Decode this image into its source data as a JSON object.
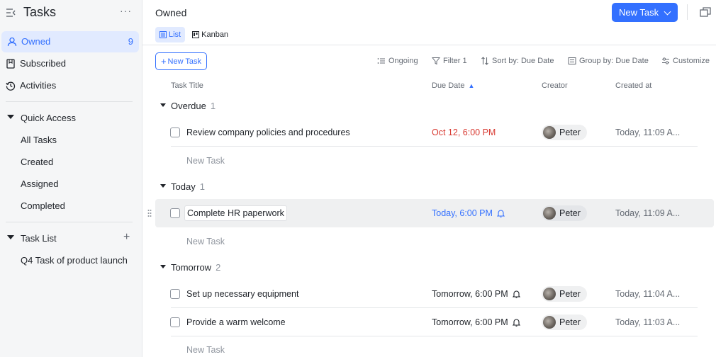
{
  "sidebar": {
    "title": "Tasks",
    "more": "···",
    "nav": [
      {
        "label": "Owned",
        "count": "9"
      },
      {
        "label": "Subscribed"
      },
      {
        "label": "Activities"
      }
    ],
    "quick_access": {
      "label": "Quick Access",
      "items": [
        "All Tasks",
        "Created",
        "Assigned",
        "Completed"
      ]
    },
    "task_list": {
      "label": "Task List",
      "add": "+",
      "items": [
        "Q4 Task of product launch"
      ]
    }
  },
  "header": {
    "title": "Owned",
    "new_task_button": "New Task",
    "views": [
      {
        "label": "List",
        "active": true
      },
      {
        "label": "Kanban",
        "active": false
      }
    ]
  },
  "toolbar": {
    "new_task": "New Task",
    "ongoing": "Ongoing",
    "filter": "Filter 1",
    "sort": "Sort by: Due Date",
    "group": "Group by: Due Date",
    "customize": "Customize"
  },
  "columns": {
    "title": "Task Title",
    "due": "Due Date",
    "creator": "Creator",
    "created": "Created at"
  },
  "groups": [
    {
      "name": "Overdue",
      "count": "1",
      "tasks": [
        {
          "title": "Review company policies and procedures",
          "due": "Oct 12, 6:00 PM",
          "bell": false,
          "creator": "Peter",
          "created": "Today, 11:09 A..."
        }
      ],
      "new_task": "New Task"
    },
    {
      "name": "Today",
      "count": "1",
      "tasks": [
        {
          "title": "Complete HR paperwork",
          "due": "Today, 6:00 PM",
          "bell": true,
          "creator": "Peter",
          "created": "Today, 11:09 A..."
        }
      ],
      "new_task": "New Task"
    },
    {
      "name": "Tomorrow",
      "count": "2",
      "tasks": [
        {
          "title": "Set up necessary equipment",
          "due": "Tomorrow, 6:00 PM",
          "bell": true,
          "creator": "Peter",
          "created": "Today, 11:04 A..."
        },
        {
          "title": "Provide a warm welcome",
          "due": "Tomorrow, 6:00 PM",
          "bell": true,
          "creator": "Peter",
          "created": "Today, 11:03 A..."
        }
      ],
      "new_task": "New Task"
    }
  ],
  "colors": {
    "accent": "#3370ff",
    "overdue": "#d83931",
    "today": "#3370ff",
    "text": "#1f2329",
    "muted": "#646a73"
  }
}
